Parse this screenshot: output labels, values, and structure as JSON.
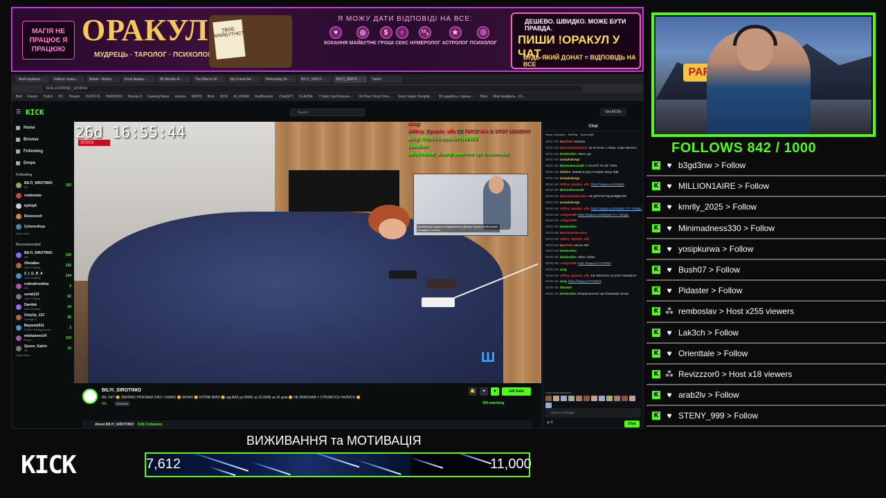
{
  "banner": {
    "left_note": "МАГІЯ НЕ ПРАЦЮЄ Я ПРАЦЮЮ",
    "brand": "ОРАКУЛ",
    "brand_sub": "МУДРЕЦЬ · ТАРОЛОГ · ПСИХОЛОГ",
    "card_text": "ТВОЄ МАЙБУТНЄ?",
    "question": "Я МОЖУ ДАТИ ВІДПОВІДІ НА ВСЕ:",
    "topics": [
      "КОХАННЯ",
      "МАЙБУТНЄ",
      "ГРОШІ",
      "СЕКС",
      "НУМЕРОЛОГ",
      "АСТРОЛОГ",
      "ПСИХОЛОГ"
    ],
    "right_line1": "ДЕШЕВО. ШВИДКО. МОЖЕ БУТИ ПРАВДА.",
    "right_line2": "ПИШИ !ОРАКУЛ У ЧАТ",
    "right_line3": "БУДЬ-ЯКИЙ ДОНАТ = ВІДПОВІДЬ НА ВСЕ"
  },
  "browser": {
    "tabs": [
      "Brief explanat…",
      "Fallout: новоє…",
      "Мовія - Notion",
      "Dock Армор…",
      "86 Needle dl…",
      "The Bike to M…",
      "My Friend Ad…",
      "Refreshing Gr…",
      "BILYI_SIROT…",
      "BILYI_SIROT…",
      "Twitch"
    ],
    "url": "kick.com/bilyi_sirotinio",
    "bookmarks": [
      "Bolt",
      "Kravar",
      "Twitch",
      "PC",
      "Розкол",
      "ГЕРОЇ 21",
      "HEROES3",
      "Heroes 3",
      "Gaming News",
      "Games",
      "MODS",
      "Bots",
      "KICK",
      "AI_WORK",
      "KeyBoarder",
      "ChatGPT",
      "CLAUDE",
      "7 Data Card Recove…",
      "24 Hour Clock Time…",
      "Sony Vegas Templat…",
      "3D шрифты, страни…",
      "Tilms",
      "Мой профиль - OL…"
    ]
  },
  "kick": {
    "logo": "KICK",
    "search_placeholder": "Search",
    "get_kicks": "Get KICKs",
    "nav": [
      "Home",
      "Browse",
      "Following",
      "Drops"
    ],
    "following_title": "Following",
    "following": [
      {
        "name": "BILYI_SIROTINIO",
        "sub": "IRL",
        "viewers": "160"
      },
      {
        "name": "remboslav",
        "sub": "",
        "viewers": ""
      },
      {
        "name": "ilyKilyK",
        "sub": "",
        "viewers": ""
      },
      {
        "name": "Revizzzor0",
        "sub": "",
        "viewers": ""
      },
      {
        "name": "Ccheresfnya",
        "sub": "",
        "viewers": ""
      }
    ],
    "show_more": "Show More",
    "recommended_title": "Recommended",
    "recommended": [
      {
        "name": "BILYI_SIROTINIO",
        "sub": "IRL",
        "viewers": "160"
      },
      {
        "name": "Olivia8ve",
        "sub": "Just Chatting",
        "viewers": "130"
      },
      {
        "name": "Z_I_G_R_A",
        "sub": "Just Chatting",
        "viewers": "134"
      },
      {
        "name": "rodinafromthai",
        "sub": "IRL",
        "viewers": "0"
      },
      {
        "name": "serial133",
        "sub": "Just Chatting",
        "viewers": "82"
      },
      {
        "name": "Dan4uk",
        "sub": "Just Chatting",
        "viewers": "24"
      },
      {
        "name": "OnlyUp_123",
        "sub": "Lineage II",
        "viewers": "26"
      },
      {
        "name": "Bayaniat911",
        "sub": "PUBG: Battlegrounds",
        "viewers": "2"
      },
      {
        "name": "mishainner24",
        "sub": "Poker",
        "viewers": "119"
      },
      {
        "name": "Queen_Katrin",
        "sub": "IRL",
        "viewers": "16"
      }
    ],
    "show_less": "Show Less"
  },
  "video": {
    "timer": "26d 16:55:44",
    "timer_badge": "90005",
    "overlay": [
      {
        "text": "azog:",
        "color": "#ff3b3b"
      },
      {
        "text": "Jeffrey_Epstein_offc ЕЕ ПИСЕЧКА В ЭТОТ МОМЕНТ",
        "color": "#ff3b3b"
      },
      {
        "text": "azog: https://kappa.io/YH3NZ0",
        "color": "#53fc18"
      },
      {
        "text": "Skewlan:",
        "color": "#53fc18"
      },
      {
        "text": "belokoshko: йозеф менгеле ще близнюків",
        "color": "#53fc18"
      }
    ],
    "pip_caption": "Донаматори видео в повідомлення Донату проти Ma Московік нападіння платна"
  },
  "stream": {
    "name": "BILYI_SIROTINIO",
    "title": "IRL 24/7 😊 ЗБИРАЮ РЮКЗАКИ ІНКУ І ОФАЮ 😊 ФІНАЛ 😊 КУПИВ BMW 😊 від ВАЗ до BMW за 20.000$ за 30 днів 😊 НЕ ВИКОНАВ = СТРИЖУСЬ НАЛИСО 😊",
    "category": "IRL",
    "language": "Ukrainian",
    "gift_subs": "Gift Subs",
    "viewers": "160 watching",
    "about": "About BILYI_SIROTINIO",
    "followers": "9.6K Followers"
  },
  "chat": {
    "header": "Chat",
    "pinned": [
      "Sonic_Knuckles",
      "ElinPlay",
      "BoredellyK"
    ],
    "messages": [
      {
        "time": "08:51 AM",
        "user": "BpoTeuh",
        "color": "#ff6a3a",
        "text": "ахахаха"
      },
      {
        "time": "08:51 AM",
        "user": "MaximumSemukov",
        "color": "#ff3b3b",
        "text": "ця не встає з ліжка, а вже кричить"
      },
      {
        "time": "08:51 AM",
        "user": "belokoshko",
        "color": "#53fc18",
        "text": "Хвать цю"
      },
      {
        "time": "08:51 AM",
        "user": "arunphalungv",
        "color": "#ffcc40",
        "text": ""
      },
      {
        "time": "08:51 AM",
        "user": "Minimadness330",
        "color": "#53fc18",
        "text": "А НАХУЙ ТИ ЛІГ ГЛЕК"
      },
      {
        "time": "08:51 AM",
        "user": "chehn3",
        "color": "#ffcc40",
        "text": "тримай в руці телефон якщо ЛІДІ"
      },
      {
        "time": "08:51 AM",
        "user": "arunphalungv",
        "color": "#ffcc40",
        "text": ""
      },
      {
        "time": "08:52 AM",
        "user": "Jeffrey_Epstein_offc",
        "color": "#ff3b3b",
        "text": "https://kappa.io/obRQwb",
        "link": true
      },
      {
        "time": "08:52 AM",
        "user": "Minimadness330",
        "color": "#53fc18",
        "text": ""
      },
      {
        "time": "08:52 AM",
        "user": "MaximumSemukov",
        "color": "#ff3b3b",
        "text": "НЕ ДРОЧИ ПІД КОВДРОЮ"
      },
      {
        "time": "08:52 AM",
        "user": "arunphalungv",
        "color": "#ffcc40",
        "text": ""
      },
      {
        "time": "08:52 AM",
        "user": "Jeffrey_Epstein_offc",
        "color": "#ff3b3b",
        "text": "https://kappa.io/obRQwb ТУТ ПИЗДА",
        "link": true
      },
      {
        "time": "08:52 AM",
        "user": "Letitgo1489",
        "color": "#ff3b3b",
        "text": "https://kappa.io/obRQwb ТУТ ПИЗДА",
        "link": true
      },
      {
        "time": "08:52 AM",
        "user": "Letitgo1489",
        "color": "#ff3b3b",
        "text": ""
      },
      {
        "time": "08:53 AM",
        "user": "belokoshko",
        "color": "#53fc18",
        "text": ""
      },
      {
        "time": "08:53 AM",
        "user": "MaximumSemukov",
        "color": "#ff3b3b",
        "text": ""
      },
      {
        "time": "08:53 AM",
        "user": "Jeffrey_Epstein_offc",
        "color": "#ff3b3b",
        "text": ""
      },
      {
        "time": "08:54 AM",
        "user": "BpoTeuh",
        "color": "#ff6a3a",
        "text": "рясніє 200"
      },
      {
        "time": "08:54 AM",
        "user": "belokoshko",
        "color": "#53fc18",
        "text": ""
      },
      {
        "time": "08:55 AM",
        "user": "belokoshko",
        "color": "#53fc18",
        "text": "Хвать хуйне"
      },
      {
        "time": "08:55 AM",
        "user": "Letitgo1489",
        "color": "#ff3b3b",
        "text": "https://kappa.io/YH3NZ0",
        "link": true
      },
      {
        "time": "08:55 AM",
        "user": "azog",
        "color": "#53fc18",
        "text": ""
      },
      {
        "time": "08:55 AM",
        "user": "Jeffrey_Epstein_offc",
        "color": "#ff3b3b",
        "text": "ЕЕ ПИСЕЧКА В ЭТОТ МОМЕНТ"
      },
      {
        "time": "08:55 AM",
        "user": "azog",
        "color": "#53fc18",
        "text": "https://kappa.io/YH3NZ0",
        "link": true
      },
      {
        "time": "08:56 AM",
        "user": "Skewlan",
        "color": "#53fc18",
        "text": ""
      },
      {
        "time": "08:56 AM",
        "user": "belokoshko",
        "color": "#53fc18",
        "text": "йозеф менгеле ще близнюків хочеш"
      }
    ],
    "slow_mode": "Slow mode activated",
    "input_placeholder": "Send a message",
    "points": "0",
    "send": "Chat"
  },
  "webcam": {
    "sign": "PARO"
  },
  "follows": {
    "title": "FOLLOWS 842 / 1000",
    "items": [
      {
        "name": "b3gd3nw",
        "action": "> Follow",
        "icon": "heart-icon"
      },
      {
        "name": "MILLION1AIRE",
        "action": "> Follow",
        "icon": "heart-icon"
      },
      {
        "name": "kmrlly_2025",
        "action": "> Follow",
        "icon": "heart-icon"
      },
      {
        "name": "Minimadness330",
        "action": "> Follow",
        "icon": "heart-icon"
      },
      {
        "name": "yosipkurwa",
        "action": "> Follow",
        "icon": "heart-icon"
      },
      {
        "name": "Bush07",
        "action": "> Follow",
        "icon": "heart-icon"
      },
      {
        "name": "Pidaster",
        "action": "> Follow",
        "icon": "heart-icon"
      },
      {
        "name": "remboslav",
        "action": "> Host x255 viewers",
        "icon": "users-icon"
      },
      {
        "name": "Lak3ch",
        "action": "> Follow",
        "icon": "heart-icon"
      },
      {
        "name": "Orienttale",
        "action": "> Follow",
        "icon": "heart-icon"
      },
      {
        "name": "Revizzzor0",
        "action": "> Host x18 viewers",
        "icon": "users-icon"
      },
      {
        "name": "arab2lv",
        "action": "> Follow",
        "icon": "heart-icon"
      },
      {
        "name": "STENY_999",
        "action": "> Follow",
        "icon": "heart-icon"
      }
    ]
  },
  "goal": {
    "logo": "KICK",
    "title": "ВИЖИВАННЯ та МОТИВАЦІЯ",
    "current": "7,612",
    "target": "11,000",
    "progress": 0.692
  },
  "colors": {
    "kick_green": "#53fc18",
    "banner_border": "#c03ce0"
  }
}
